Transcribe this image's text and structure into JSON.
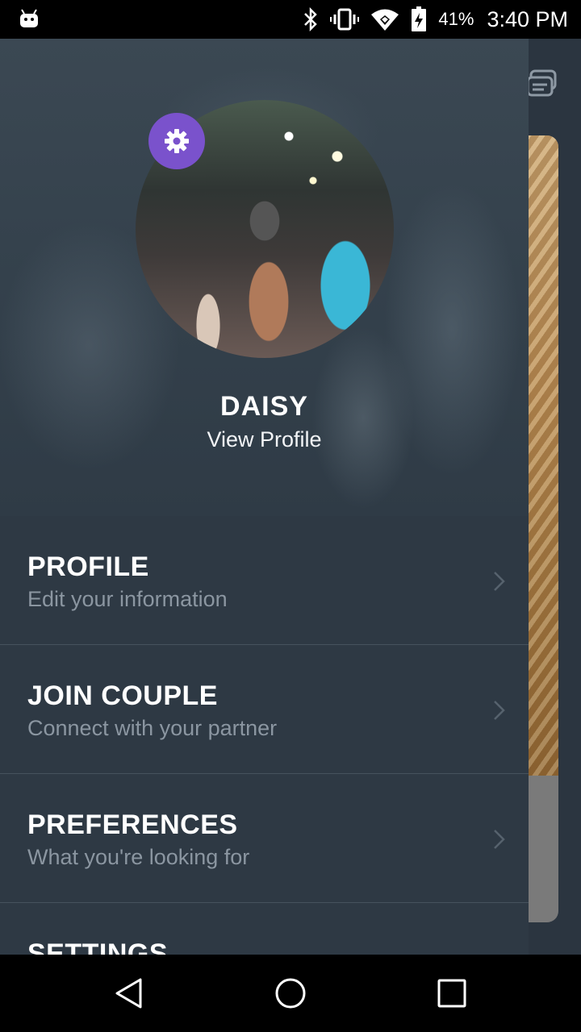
{
  "status_bar": {
    "battery_percent": "41%",
    "time": "3:40 PM",
    "icons": [
      "android-icon",
      "bluetooth-icon",
      "vibrate-icon",
      "wifi-icon",
      "battery-icon"
    ]
  },
  "profile": {
    "name": "DAISY",
    "view_profile_label": "View Profile"
  },
  "menu": {
    "items": [
      {
        "title": "PROFILE",
        "subtitle": "Edit your information"
      },
      {
        "title": "JOIN COUPLE",
        "subtitle": "Connect with your partner"
      },
      {
        "title": "PREFERENCES",
        "subtitle": "What you're looking for"
      },
      {
        "title": "SETTINGS",
        "subtitle": ""
      }
    ]
  },
  "colors": {
    "drawer_bg": "#2e3944",
    "accent_purple": "#7a52cc",
    "subtitle_gray": "#8b96a1"
  },
  "nav_bar": {
    "icons": [
      "back-icon",
      "home-icon",
      "recents-icon"
    ]
  }
}
